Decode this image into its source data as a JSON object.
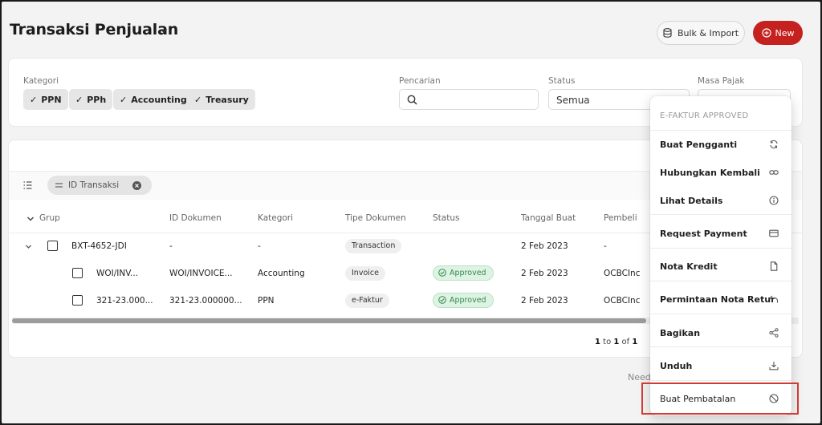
{
  "header": {
    "title": "Transaksi Penjualan",
    "bulk_label": "Bulk & Import",
    "new_label": "New"
  },
  "filters": {
    "kategori_label": "Kategori",
    "chips": [
      "PPN",
      "PPh",
      "Accounting",
      "Treasury"
    ],
    "pencarian_label": "Pencarian",
    "search_placeholder": "",
    "status_label": "Status",
    "status_value": "Semua",
    "masa_pajak_label": "Masa Pajak"
  },
  "table": {
    "group_chip": "ID Transaksi",
    "columns": [
      "Grup",
      "ID Dokumen",
      "Kategori",
      "Tipe Dokumen",
      "Status",
      "Tanggal Buat",
      "Pembeli"
    ],
    "group_row": {
      "grup": "BXT-4652-JDI",
      "id_dokumen": "-",
      "kategori": "-",
      "tipe": "Transaction",
      "status": "",
      "tanggal": "2 Feb 2023",
      "pembeli": "-"
    },
    "rows": [
      {
        "grup": "WOI/INV...",
        "id_dokumen": "WOI/INVOICE...",
        "kategori": "Accounting",
        "tipe": "Invoice",
        "status": "Approved",
        "tanggal": "2 Feb 2023",
        "pembeli": "OCBCInc"
      },
      {
        "grup": "321-23.000...",
        "id_dokumen": "321-23.000000...",
        "kategori": "PPN",
        "tipe": "e-Faktur",
        "status": "Approved",
        "tanggal": "2 Feb 2023",
        "pembeli": "OCBCInc"
      }
    ],
    "pager": {
      "from": "1",
      "to_word": "to",
      "to": "1",
      "of_word": "of",
      "total": "1"
    }
  },
  "footer_hint": "Need",
  "menu": {
    "section": "E-FAKTUR APPROVED",
    "items": [
      {
        "label": "Buat Pengganti",
        "icon": "refresh-icon"
      },
      {
        "label": "Hubungkan Kembali",
        "icon": "link-icon"
      },
      {
        "label": "Lihat Details",
        "icon": "info-icon"
      },
      {
        "label": "Request Payment",
        "icon": "card-icon"
      },
      {
        "label": "Nota Kredit",
        "icon": "document-icon"
      },
      {
        "label": "Permintaan Nota Retur",
        "icon": "undo-icon"
      },
      {
        "label": "Bagikan",
        "icon": "share-icon"
      },
      {
        "label": "Unduh",
        "icon": "download-icon"
      },
      {
        "label": "Buat Pembatalan",
        "icon": "cancel-icon"
      }
    ]
  },
  "colors": {
    "brand_red": "#c5221f",
    "approved_green": "#2f8a49",
    "highlight_red": "#d23a35"
  }
}
